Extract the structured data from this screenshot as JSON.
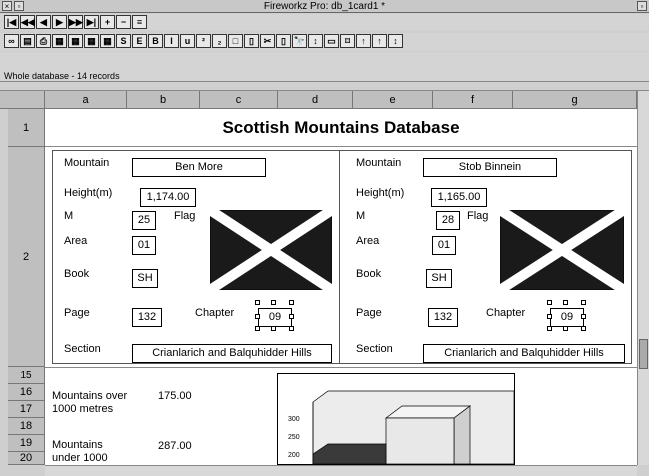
{
  "window": {
    "title": "Fireworkz Pro: db_1card1 *"
  },
  "toolbar1": [
    "|◀",
    "◀◀",
    "◀",
    "▶",
    "▶▶",
    "▶|",
    "+",
    "−",
    "≡"
  ],
  "toolbar2": [
    "∞",
    "▤",
    "⎙",
    "▦",
    "▦",
    "▦",
    "▦",
    "S",
    "E",
    "B",
    "I",
    "u",
    "²",
    "₂",
    "□",
    "▯",
    "✂",
    "▯",
    "🔭",
    "↕",
    "▭",
    "⌑",
    "↑",
    "↑",
    "↕"
  ],
  "status": "Whole database - 14 records",
  "columns": [
    "a",
    "b",
    "c",
    "d",
    "e",
    "f",
    "g"
  ],
  "rows": [
    "1",
    "2",
    "15",
    "16",
    "17",
    "18",
    "19",
    "20"
  ],
  "heading": "Scottish Mountains Database",
  "labels": {
    "mountain": "Mountain",
    "height": "Height(m)",
    "m": "M",
    "area": "Area",
    "book": "Book",
    "page": "Page",
    "section": "Section",
    "flag": "Flag",
    "chapter": "Chapter"
  },
  "card1": {
    "mountain": "Ben More",
    "height": "1,174.00",
    "m": "25",
    "area": "01",
    "book": "SH",
    "page": "132",
    "chapter": "09",
    "section": "Crianlarich and Balquhidder Hills"
  },
  "card2": {
    "mountain": "Stob Binnein",
    "height": "1,165.00",
    "m": "28",
    "area": "01",
    "book": "SH",
    "page": "132",
    "chapter": "09",
    "section": "Crianlarich and Balquhidder Hills"
  },
  "summary": [
    {
      "label": "Mountains over 1000 metres",
      "value": "175.00"
    },
    {
      "label": "Mountains under 1000",
      "value": "287.00"
    }
  ],
  "chart_data": {
    "type": "bar",
    "ylim": [
      200,
      300
    ],
    "yticks": [
      "300",
      "250",
      "200"
    ]
  },
  "colors": {
    "flag_blue": "#1a1a1a",
    "flag_cross": "#ffffff",
    "header_gray": "#bfbfbf"
  }
}
